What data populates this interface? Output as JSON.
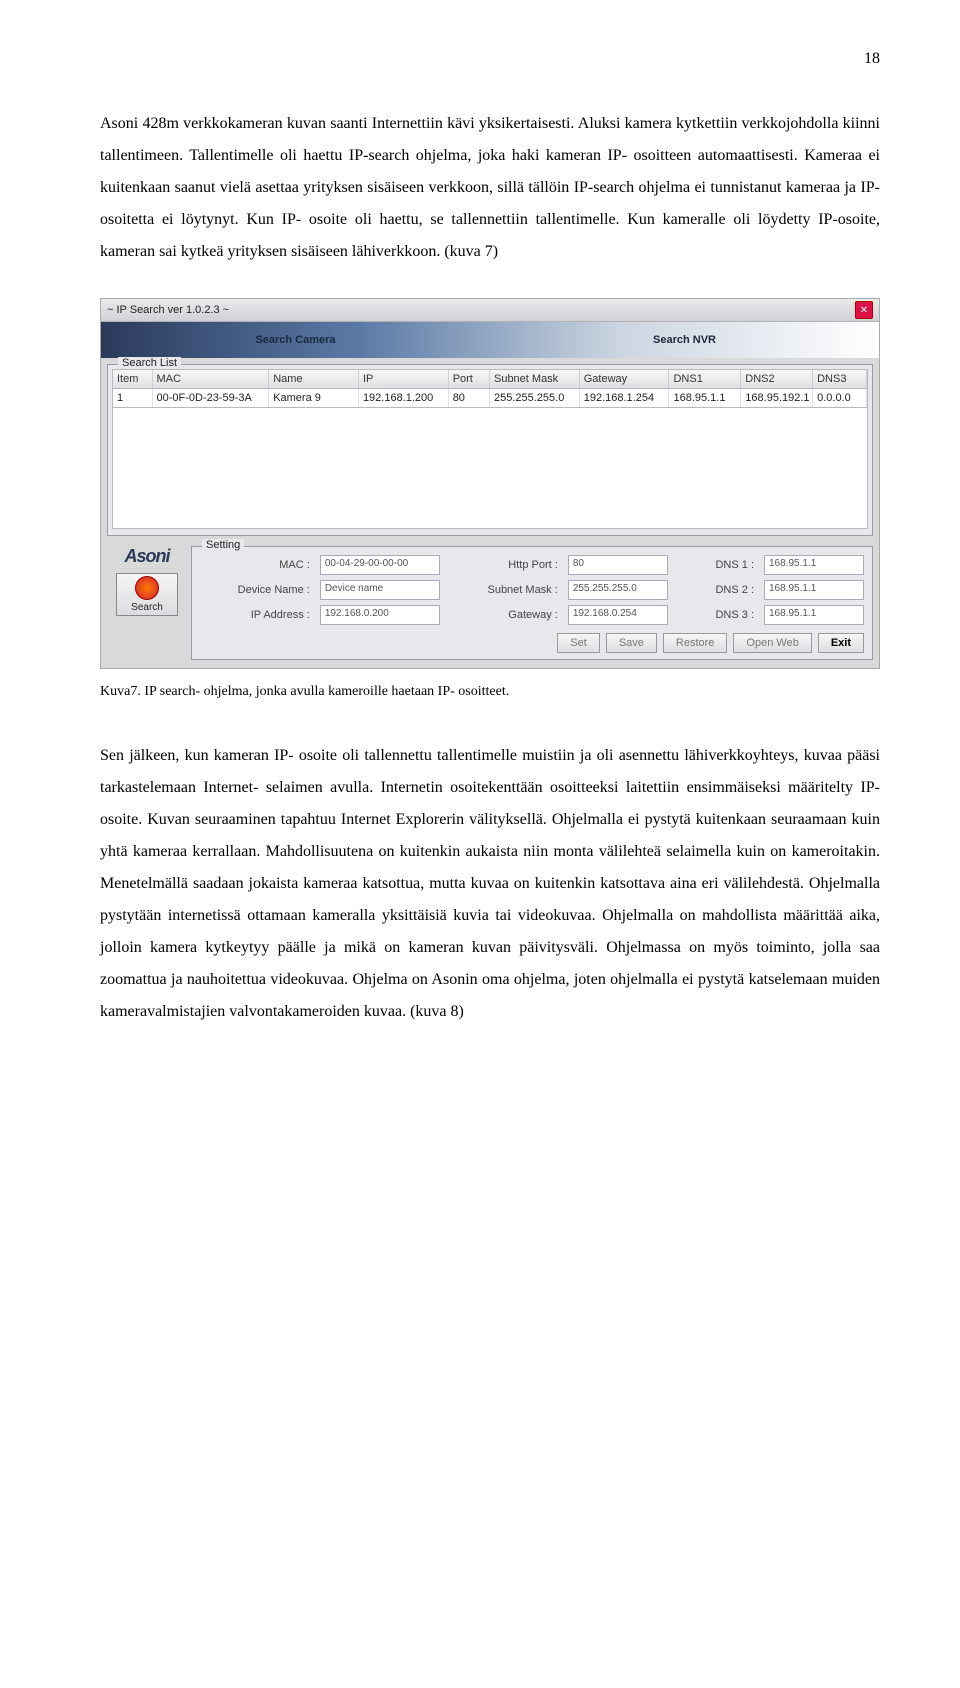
{
  "page_number": "18",
  "para1": "Asoni 428m verkkokameran kuvan saanti Internettiin kävi yksikertaisesti. Aluksi kamera kytkettiin verkkojohdolla kiinni tallentimeen. Tallentimelle oli haettu IP-search ohjelma, joka haki kameran IP- osoitteen automaattisesti. Kameraa ei kuitenkaan saanut vielä asettaa yrityksen sisäiseen verkkoon, sillä tällöin IP-search ohjelma ei tunnistanut kameraa ja IP- osoitetta ei löytynyt. Kun IP- osoite oli haettu, se tallennettiin tallentimelle. Kun kameralle oli löydetty IP-osoite, kameran sai kytkeä yrityksen sisäiseen lähiverkkoon. (kuva 7)",
  "app": {
    "title": "~ IP Search ver 1.0.2.3 ~",
    "tab_camera": "Search Camera",
    "tab_nvr": "Search NVR",
    "search_list": "Search List",
    "cols": {
      "item": "Item",
      "mac": "MAC",
      "name": "Name",
      "ip": "IP",
      "port": "Port",
      "subnet": "Subnet Mask",
      "gw": "Gateway",
      "dns1": "DNS1",
      "dns2": "DNS2",
      "dns3": "DNS3"
    },
    "row": {
      "item": "1",
      "mac": "00-0F-0D-23-59-3A",
      "name": "Kamera 9",
      "ip": "192.168.1.200",
      "port": "80",
      "subnet": "255.255.255.0",
      "gw": "192.168.1.254",
      "dns1": "168.95.1.1",
      "dns2": "168.95.192.1",
      "dns3": "0.0.0.0"
    },
    "logo": "Asoni",
    "search_button": "Search",
    "setting": {
      "label": "Setting",
      "mac_l": "MAC :",
      "mac_v": "00-04-29-00-00-00",
      "device_l": "Device Name :",
      "device_v": "Device name",
      "ip_l": "IP Address :",
      "ip_v": "192.168.0.200",
      "http_l": "Http Port :",
      "http_v": "80",
      "subnet_l": "Subnet Mask :",
      "subnet_v": "255.255.255.0",
      "gw_l": "Gateway :",
      "gw_v": "192.168.0.254",
      "dns1_l": "DNS 1 :",
      "dns1_v": "168.95.1.1",
      "dns2_l": "DNS 2 :",
      "dns2_v": "168.95.1.1",
      "dns3_l": "DNS 3 :",
      "dns3_v": "168.95.1.1"
    },
    "buttons": {
      "set": "Set",
      "save": "Save",
      "restore": "Restore",
      "open_web": "Open Web",
      "exit": "Exit"
    }
  },
  "caption": "Kuva7. IP search- ohjelma, jonka avulla kameroille haetaan IP- osoitteet.",
  "para2": "Sen jälkeen, kun kameran IP- osoite oli tallennettu tallentimelle muistiin ja oli asennettu lähiverkkoyhteys, kuvaa pääsi tarkastelemaan Internet- selaimen avulla. Internetin osoitekenttään osoitteeksi laitettiin ensimmäiseksi määritelty IP- osoite. Kuvan seuraaminen tapahtuu Internet Explorerin välityksellä. Ohjelmalla ei pystytä kuitenkaan seuraamaan kuin yhtä kameraa kerrallaan. Mahdollisuutena on kuitenkin aukaista niin monta välilehteä selaimella kuin on kameroitakin. Menetelmällä saadaan jokaista kameraa katsottua, mutta kuvaa on kuitenkin katsottava aina eri välilehdestä. Ohjelmalla pystytään internetissä ottamaan kameralla yksittäisiä kuvia tai videokuvaa. Ohjelmalla on mahdollista määrittää aika, jolloin kamera kytkeytyy päälle ja mikä on kameran kuvan päivitysväli. Ohjelmassa on myös toiminto, jolla saa zoomattua ja nauhoitettua videokuvaa. Ohjelma on Asonin oma ohjelma, joten ohjelmalla ei pystytä katselemaan muiden kameravalmistajien valvontakameroiden kuvaa. (kuva 8)"
}
